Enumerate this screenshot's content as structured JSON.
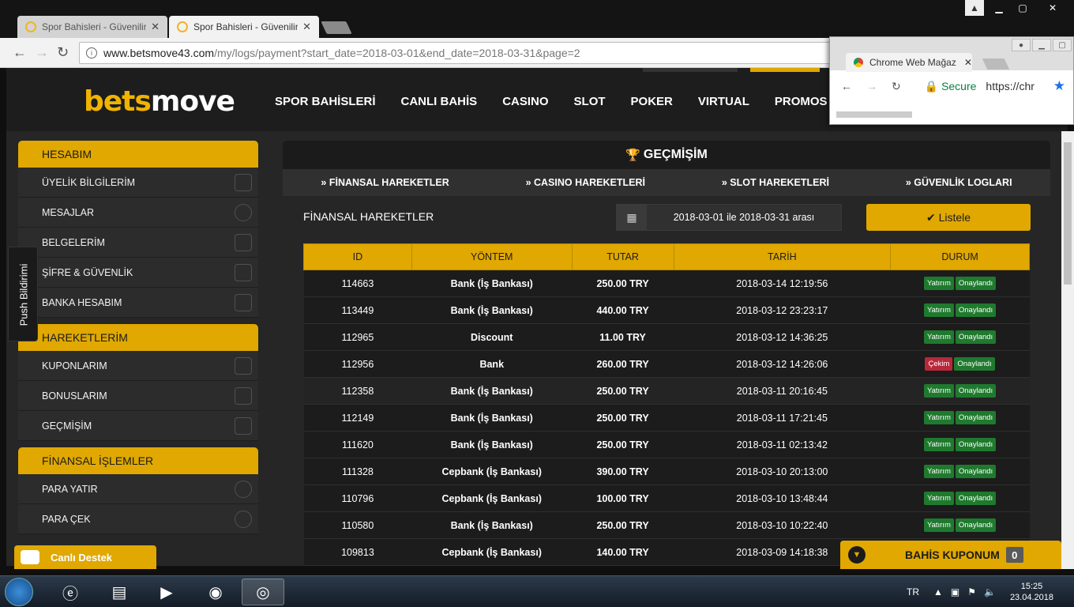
{
  "browser": {
    "tabs": [
      {
        "title": "Spor Bahisleri - Güvenilir",
        "active": false
      },
      {
        "title": "Spor Bahisleri - Güvenilir",
        "active": true
      }
    ],
    "url_host": "www.betsmove43.com",
    "url_path": "/my/logs/payment?start_date=2018-03-01&end_date=2018-03-31&page=2"
  },
  "site": {
    "logo_a": "bets",
    "logo_b": "move",
    "nav": [
      "SPOR BAHİSLERİ",
      "CANLI BAHİS",
      "CASINO",
      "SLOT",
      "POKER",
      "VIRTUAL",
      "PROMOS"
    ]
  },
  "sidebar": {
    "sections": [
      {
        "title": "HESABIM",
        "items": [
          "ÜYELİK BİLGİLERİM",
          "MESAJLAR",
          "BELGELERİM",
          "ŞİFRE & GÜVENLİK",
          "BANKA HESABIM"
        ]
      },
      {
        "title": "HAREKETLERİM",
        "items": [
          "KUPONLARIM",
          "BONUSLARIM",
          "GEÇMİŞİM"
        ]
      },
      {
        "title": "FİNANSAL İŞLEMLER",
        "items": [
          "PARA YATIR",
          "PARA ÇEK"
        ]
      }
    ]
  },
  "panel": {
    "title": "GEÇMİŞİM",
    "sub_tabs": [
      "FİNANSAL HAREKETLER",
      "CASINO HAREKETLERİ",
      "SLOT HAREKETLERİ",
      "GÜVENLİK LOGLARI"
    ],
    "section_title": "FİNANSAL HAREKETLER",
    "date_range": "2018-03-01 ile 2018-03-31 arası",
    "listele": "Listele",
    "columns": [
      "ID",
      "YÖNTEM",
      "TUTAR",
      "TARİH",
      "DURUM"
    ],
    "rows": [
      {
        "id": "114663",
        "method": "Bank (İş Bankası)",
        "amount": "250.00 TRY",
        "date": "2018-03-14 12:19:56",
        "type": "Yatırım",
        "status": "Onaylandı"
      },
      {
        "id": "113449",
        "method": "Bank (İş Bankası)",
        "amount": "440.00 TRY",
        "date": "2018-03-12 23:23:17",
        "type": "Yatırım",
        "status": "Onaylandı"
      },
      {
        "id": "112965",
        "method": "Discount",
        "amount": "11.00 TRY",
        "date": "2018-03-12 14:36:25",
        "type": "Yatırım",
        "status": "Onaylandı"
      },
      {
        "id": "112956",
        "method": "Bank",
        "amount": "260.00 TRY",
        "date": "2018-03-12 14:26:06",
        "type": "Çekim",
        "status": "Onaylandı"
      },
      {
        "id": "112358",
        "method": "Bank (İş Bankası)",
        "amount": "250.00 TRY",
        "date": "2018-03-11 20:16:45",
        "type": "Yatırım",
        "status": "Onaylandı"
      },
      {
        "id": "112149",
        "method": "Bank (İş Bankası)",
        "amount": "250.00 TRY",
        "date": "2018-03-11 17:21:45",
        "type": "Yatırım",
        "status": "Onaylandı"
      },
      {
        "id": "111620",
        "method": "Bank (İş Bankası)",
        "amount": "250.00 TRY",
        "date": "2018-03-11 02:13:42",
        "type": "Yatırım",
        "status": "Onaylandı"
      },
      {
        "id": "111328",
        "method": "Cepbank (İş Bankası)",
        "amount": "390.00 TRY",
        "date": "2018-03-10 20:13:00",
        "type": "Yatırım",
        "status": "Onaylandı"
      },
      {
        "id": "110796",
        "method": "Cepbank (İş Bankası)",
        "amount": "100.00 TRY",
        "date": "2018-03-10 13:48:44",
        "type": "Yatırım",
        "status": "Onaylandı"
      },
      {
        "id": "110580",
        "method": "Bank (İş Bankası)",
        "amount": "250.00 TRY",
        "date": "2018-03-10 10:22:40",
        "type": "Yatırım",
        "status": "Onaylandı"
      },
      {
        "id": "109813",
        "method": "Cepbank (İş Bankası)",
        "amount": "140.00 TRY",
        "date": "2018-03-09 14:18:38",
        "type": "Yatırım",
        "status": "Onaylandı"
      }
    ]
  },
  "floating": {
    "push": "Push Bildirimi",
    "destek": "Canlı Destek",
    "kupon": "BAHİS KUPONUM",
    "kupon_count": "0"
  },
  "win2": {
    "tab_title": "Chrome Web Mağaz",
    "secure": "Secure",
    "url": "https://chr"
  },
  "taskbar": {
    "lang": "TR",
    "time": "15:25",
    "date": "23.04.2018"
  },
  "colors": {
    "accent": "#e0a800",
    "bg": "#262626",
    "green_badge": "#1f7a2e",
    "red_badge": "#b8283a"
  }
}
